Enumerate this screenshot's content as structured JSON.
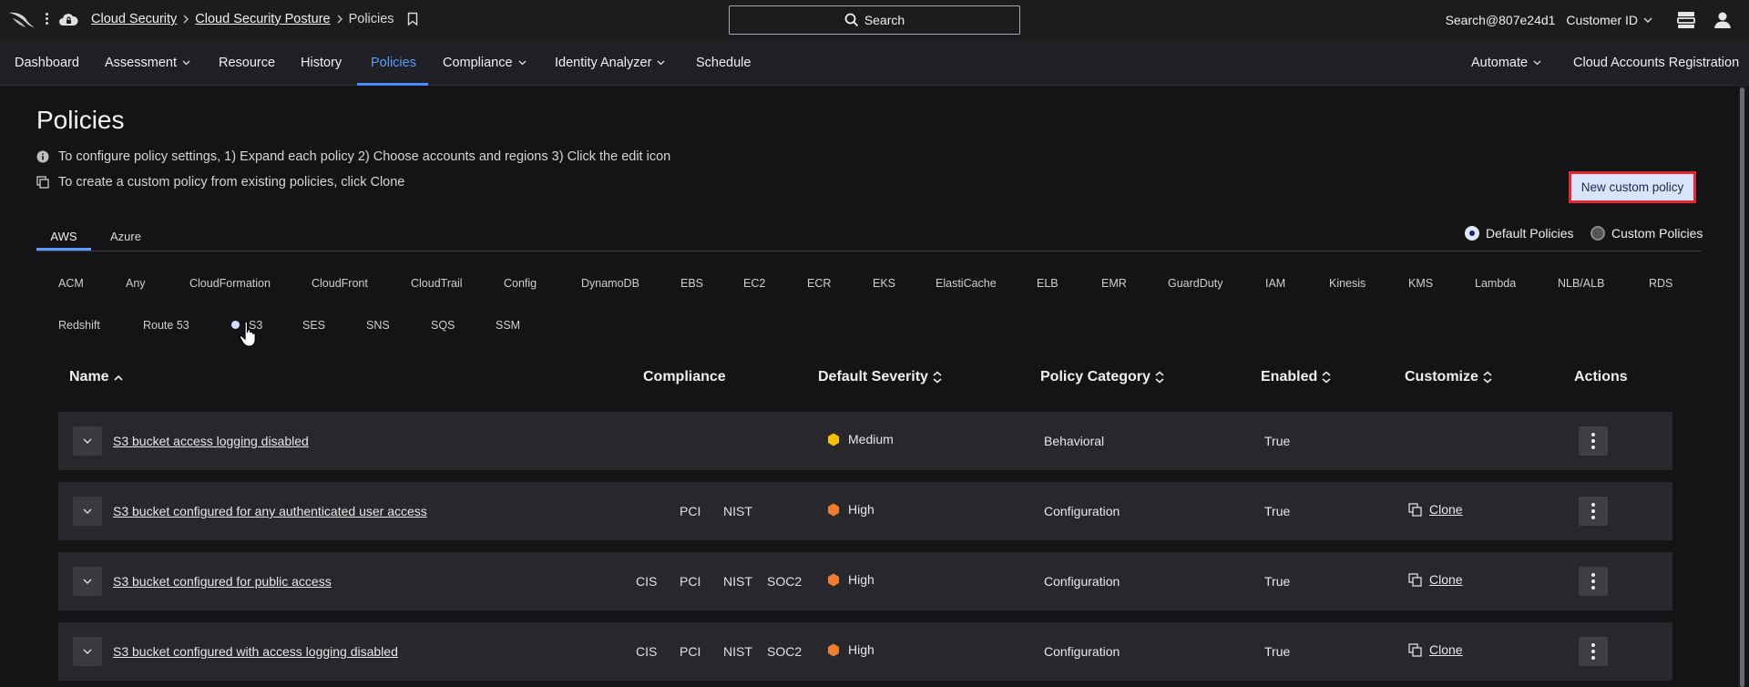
{
  "breadcrumb": {
    "items": [
      "Cloud Security",
      "Cloud Security Posture"
    ],
    "current": "Policies"
  },
  "search": {
    "label": "Search"
  },
  "user": {
    "id": "Search@807e24d1",
    "customer": "Customer ID"
  },
  "nav": {
    "items": [
      {
        "label": "Dashboard",
        "dropdown": false
      },
      {
        "label": "Assessment",
        "dropdown": true
      },
      {
        "label": "Resource",
        "dropdown": false
      },
      {
        "label": "History",
        "dropdown": false
      },
      {
        "label": "Policies",
        "dropdown": false,
        "active": true
      },
      {
        "label": "Compliance",
        "dropdown": true
      },
      {
        "label": "Identity Analyzer",
        "dropdown": true
      },
      {
        "label": "Schedule",
        "dropdown": false
      }
    ],
    "right": [
      {
        "label": "Automate",
        "dropdown": true
      },
      {
        "label": "Cloud Accounts Registration",
        "dropdown": false
      }
    ]
  },
  "page": {
    "title": "Policies",
    "info1": "To configure policy settings, 1) Expand each policy 2) Choose accounts and regions 3) Click the edit icon",
    "info2": "To create a custom policy from existing policies, click Clone",
    "new_button": "New custom policy"
  },
  "tabs": [
    "AWS",
    "Azure"
  ],
  "policy_type": {
    "default": "Default Policies",
    "custom": "Custom Policies",
    "selected": "default"
  },
  "services_row1": [
    "ACM",
    "Any",
    "CloudFormation",
    "CloudFront",
    "CloudTrail",
    "Config",
    "DynamoDB",
    "EBS",
    "EC2",
    "ECR",
    "EKS",
    "ElastiCache",
    "ELB",
    "EMR",
    "GuardDuty",
    "IAM",
    "Kinesis",
    "KMS",
    "Lambda",
    "NLB/ALB",
    "RDS"
  ],
  "services_row2": [
    "Redshift",
    "Route 53",
    "S3",
    "SES",
    "SNS",
    "SQS",
    "SSM"
  ],
  "selected_service": "S3",
  "table": {
    "headers": {
      "name": "Name",
      "compliance": "Compliance",
      "severity": "Default Severity",
      "category": "Policy Category",
      "enabled": "Enabled",
      "customize": "Customize",
      "actions": "Actions"
    },
    "rows": [
      {
        "name": "S3 bucket access logging disabled",
        "compliance": [],
        "severity": "Medium",
        "severity_color": "#f2c200",
        "category": "Behavioral",
        "enabled": "True",
        "clone": ""
      },
      {
        "name": "S3 bucket configured for any authenticated user access",
        "compliance": [
          "PCI",
          "NIST"
        ],
        "severity": "High",
        "severity_color": "#f07c2e",
        "category": "Configuration",
        "enabled": "True",
        "clone": "Clone"
      },
      {
        "name": "S3 bucket configured for public access",
        "compliance": [
          "CIS",
          "PCI",
          "NIST",
          "SOC2"
        ],
        "severity": "High",
        "severity_color": "#f07c2e",
        "category": "Configuration",
        "enabled": "True",
        "clone": "Clone"
      },
      {
        "name": "S3 bucket configured with access logging disabled",
        "compliance": [
          "CIS",
          "PCI",
          "NIST",
          "SOC2"
        ],
        "severity": "High",
        "severity_color": "#f07c2e",
        "category": "Configuration",
        "enabled": "True",
        "clone": "Clone"
      }
    ]
  }
}
